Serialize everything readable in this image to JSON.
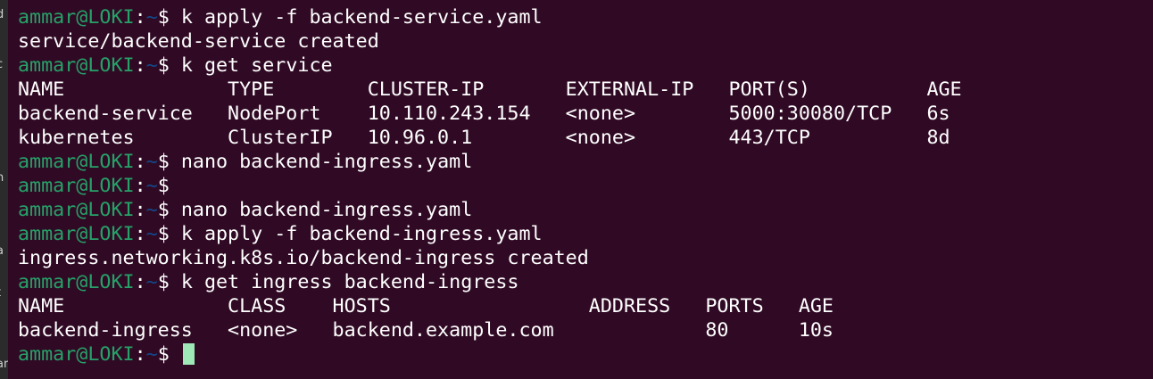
{
  "left_edge_fragments": [
    "d",
    "c",
    "n",
    "a",
    "t",
    "ar"
  ],
  "prompt": {
    "user_host": "ammar@LOKI",
    "sep": ":",
    "path": "~",
    "symbol": "$ "
  },
  "lines": [
    {
      "type": "prompt",
      "command": "k apply -f backend-service.yaml"
    },
    {
      "type": "output",
      "text": "service/backend-service created"
    },
    {
      "type": "prompt",
      "command": "k get service"
    },
    {
      "type": "output",
      "text": "NAME              TYPE        CLUSTER-IP       EXTERNAL-IP   PORT(S)          AGE"
    },
    {
      "type": "output",
      "text": "backend-service   NodePort    10.110.243.154   <none>        5000:30080/TCP   6s"
    },
    {
      "type": "output",
      "text": "kubernetes        ClusterIP   10.96.0.1        <none>        443/TCP          8d"
    },
    {
      "type": "prompt",
      "command": "nano backend-ingress.yaml"
    },
    {
      "type": "prompt",
      "command": ""
    },
    {
      "type": "prompt",
      "command": "nano backend-ingress.yaml"
    },
    {
      "type": "prompt",
      "command": "k apply -f backend-ingress.yaml"
    },
    {
      "type": "output",
      "text": "ingress.networking.k8s.io/backend-ingress created"
    },
    {
      "type": "prompt",
      "command": "k get ingress backend-ingress"
    },
    {
      "type": "output",
      "text": "NAME              CLASS    HOSTS                 ADDRESS   PORTS   AGE"
    },
    {
      "type": "output",
      "text": "backend-ingress   <none>   backend.example.com             80      10s"
    },
    {
      "type": "prompt",
      "command": "",
      "cursor": true
    }
  ],
  "colors": {
    "background": "#300a24",
    "user_host": "#26a269",
    "path": "#12488b",
    "text": "#ffffff",
    "cursor": "#9ee8b8"
  }
}
